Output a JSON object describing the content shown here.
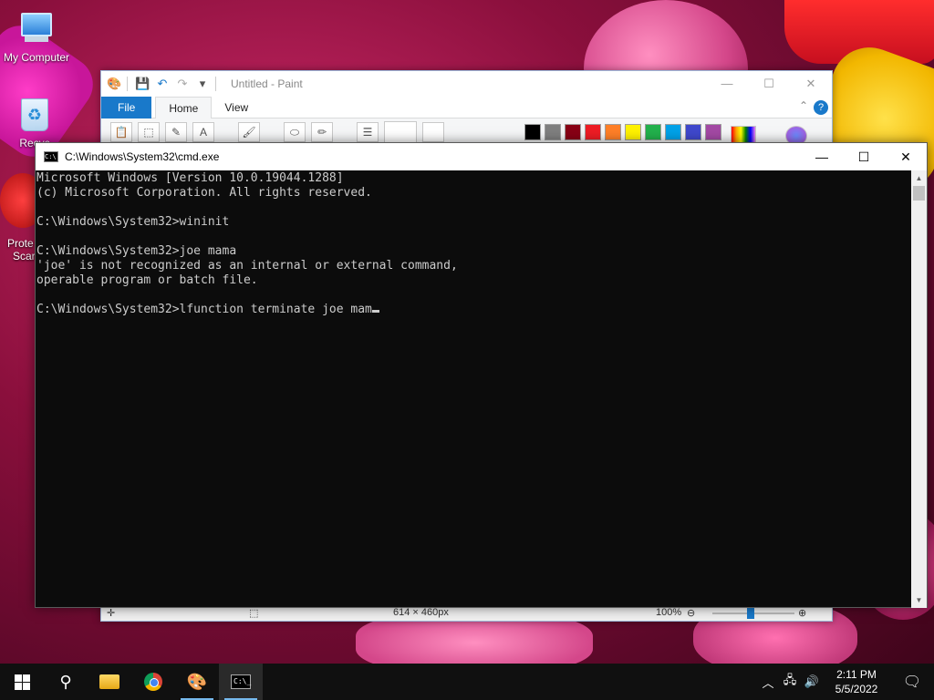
{
  "desktop": {
    "icons": [
      {
        "label": "My Computer"
      },
      {
        "label": "Recyc"
      },
      {
        "label": "Prote"
      },
      {
        "label": "Scar"
      }
    ]
  },
  "paint": {
    "title": "Untitled - Paint",
    "tabs": {
      "file": "File",
      "home": "Home",
      "view": "View"
    },
    "status": {
      "size": "614 × 460px",
      "zoom": "100%"
    },
    "palette": [
      "#000000",
      "#7f7f7f",
      "#880015",
      "#ed1c24",
      "#ff7f27",
      "#fff200",
      "#22b14c",
      "#00a2e8",
      "#3f48cc",
      "#a349a4"
    ]
  },
  "cmd": {
    "title": "C:\\Windows\\System32\\cmd.exe",
    "lines": [
      "Microsoft Windows [Version 10.0.19044.1288]",
      "(c) Microsoft Corporation. All rights reserved.",
      "",
      "C:\\Windows\\System32>wininit",
      "",
      "C:\\Windows\\System32>joe mama",
      "'joe' is not recognized as an internal or external command,",
      "operable program or batch file.",
      "",
      "C:\\Windows\\System32>lfunction terminate joe mam"
    ]
  },
  "taskbar": {
    "clock": {
      "time": "2:11 PM",
      "date": "5/5/2022"
    },
    "icons": [
      "start-icon",
      "search-icon",
      "file-explorer-icon",
      "chrome-icon",
      "paint-icon",
      "cmd-icon"
    ]
  }
}
